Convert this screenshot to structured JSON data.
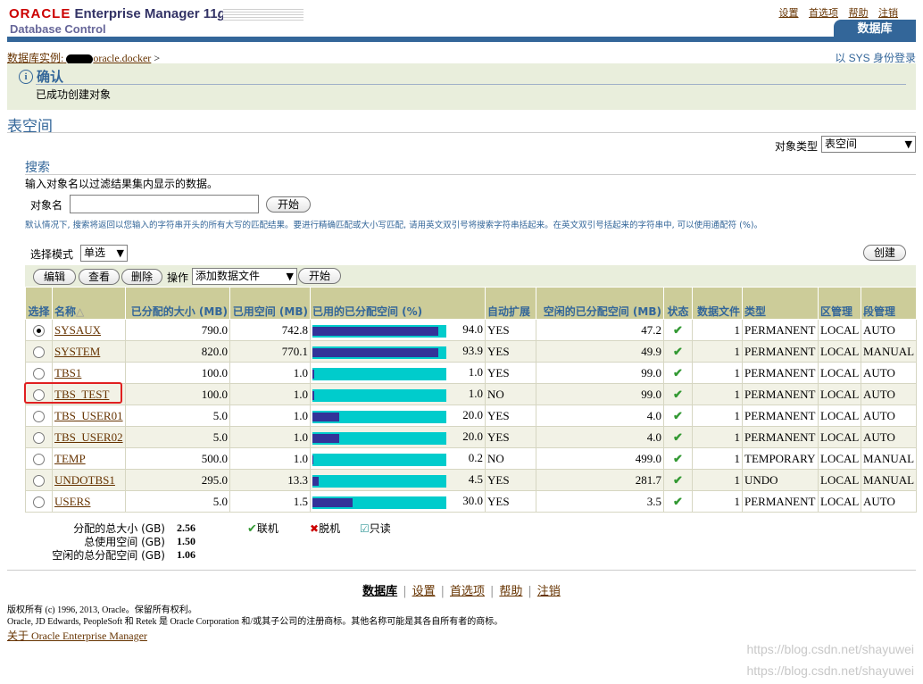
{
  "header": {
    "oracle": "ORACLE",
    "product": "Enterprise Manager 11",
    "version": "g",
    "subtitle": "Database Control",
    "global_links": [
      "设置",
      "首选项",
      "帮助",
      "注销"
    ],
    "active_tab": "数据库"
  },
  "breadcrumb": {
    "prefix": "数据库实例:",
    "instance": "oracle.docker",
    "sep": ">"
  },
  "login_as": "以 SYS 身份登录",
  "confirmation": {
    "title": "确认",
    "message": "已成功创建对象"
  },
  "page_title": "表空间",
  "object_type": {
    "label": "对象类型",
    "value": "表空间"
  },
  "search": {
    "title": "搜索",
    "description": "输入对象名以过滤结果集内显示的数据。",
    "field_label": "对象名",
    "field_value": "",
    "go_button": "开始",
    "hint": "默认情况下, 搜索将返回以您输入的字符串开头的所有大写的匹配结果。要进行精确匹配或大小写匹配, 请用英文双引号将搜索字符串括起来。在英文双引号括起来的字符串中, 可以使用通配符 (%)。"
  },
  "selection_mode": {
    "label": "选择模式",
    "value": "单选"
  },
  "create_button": "创建",
  "toolbar": {
    "edit": "编辑",
    "view": "查看",
    "delete": "删除",
    "action_label": "操作",
    "action_value": "添加数据文件",
    "go": "开始"
  },
  "table": {
    "headers": {
      "select": "选择",
      "name": "名称",
      "allocated": "已分配的大小 (MB)",
      "used": "已用空间 (MB)",
      "used_pct": "已用的已分配空间 (%)",
      "autoextend": "自动扩展",
      "free": "空闲的已分配空间 (MB)",
      "status": "状态",
      "datafiles": "数据文件",
      "type": "类型",
      "extent_mgmt": "区管理",
      "segment_mgmt": "段管理"
    },
    "rows": [
      {
        "selected": true,
        "name": "SYSAUX",
        "allocated": "790.0",
        "used": "742.8",
        "pct": "94.0",
        "pct_value": 94.0,
        "auto": "YES",
        "free": "47.2",
        "files": "1",
        "type": "PERMANENT",
        "extent": "LOCAL",
        "segment": "AUTO"
      },
      {
        "selected": false,
        "name": "SYSTEM",
        "allocated": "820.0",
        "used": "770.1",
        "pct": "93.9",
        "pct_value": 93.9,
        "auto": "YES",
        "free": "49.9",
        "files": "1",
        "type": "PERMANENT",
        "extent": "LOCAL",
        "segment": "MANUAL"
      },
      {
        "selected": false,
        "name": "TBS1",
        "allocated": "100.0",
        "used": "1.0",
        "pct": "1.0",
        "pct_value": 1.0,
        "auto": "YES",
        "free": "99.0",
        "files": "1",
        "type": "PERMANENT",
        "extent": "LOCAL",
        "segment": "AUTO"
      },
      {
        "selected": false,
        "name": "TBS_TEST",
        "allocated": "100.0",
        "used": "1.0",
        "pct": "1.0",
        "pct_value": 1.0,
        "auto": "NO",
        "free": "99.0",
        "files": "1",
        "type": "PERMANENT",
        "extent": "LOCAL",
        "segment": "AUTO"
      },
      {
        "selected": false,
        "name": "TBS_USER01",
        "allocated": "5.0",
        "used": "1.0",
        "pct": "20.0",
        "pct_value": 20.0,
        "auto": "YES",
        "free": "4.0",
        "files": "1",
        "type": "PERMANENT",
        "extent": "LOCAL",
        "segment": "AUTO"
      },
      {
        "selected": false,
        "name": "TBS_USER02",
        "allocated": "5.0",
        "used": "1.0",
        "pct": "20.0",
        "pct_value": 20.0,
        "auto": "YES",
        "free": "4.0",
        "files": "1",
        "type": "PERMANENT",
        "extent": "LOCAL",
        "segment": "AUTO"
      },
      {
        "selected": false,
        "name": "TEMP",
        "allocated": "500.0",
        "used": "1.0",
        "pct": "0.2",
        "pct_value": 0.2,
        "auto": "NO",
        "free": "499.0",
        "files": "1",
        "type": "TEMPORARY",
        "extent": "LOCAL",
        "segment": "MANUAL"
      },
      {
        "selected": false,
        "name": "UNDOTBS1",
        "allocated": "295.0",
        "used": "13.3",
        "pct": "4.5",
        "pct_value": 4.5,
        "auto": "YES",
        "free": "281.7",
        "files": "1",
        "type": "UNDO",
        "extent": "LOCAL",
        "segment": "MANUAL"
      },
      {
        "selected": false,
        "name": "USERS",
        "allocated": "5.0",
        "used": "1.5",
        "pct": "30.0",
        "pct_value": 30.0,
        "auto": "YES",
        "free": "3.5",
        "files": "1",
        "type": "PERMANENT",
        "extent": "LOCAL",
        "segment": "AUTO"
      }
    ]
  },
  "totals": {
    "allocated_label": "分配的总大小 (GB)",
    "allocated_value": "2.56",
    "used_label": "总使用空间 (GB)",
    "used_value": "1.50",
    "free_label": "空闲的总分配空间 (GB)",
    "free_value": "1.06"
  },
  "legend": {
    "online": "联机",
    "offline": "脱机",
    "readonly": "只读"
  },
  "colors": {
    "bar_used": "#333399",
    "bar_free": "#00cccc",
    "header_bg": "#cccc99",
    "brand_blue": "#336699"
  },
  "footer": {
    "links": [
      "数据库",
      "设置",
      "首选项",
      "帮助",
      "注销"
    ],
    "copyright_1": "版权所有 (c) 1996, 2013, Oracle。保留所有权利。",
    "copyright_2": "Oracle, JD Edwards, PeopleSoft 和 Retek 是 Oracle Corporation 和/或其子公司的注册商标。其他名称可能是其各自所有者的商标。",
    "about": "关于 Oracle Enterprise Manager"
  },
  "watermark": {
    "line1": "https://blog.csdn.net/shayuwei",
    "line2": "https://blog.csdn.net/shayuwei"
  }
}
